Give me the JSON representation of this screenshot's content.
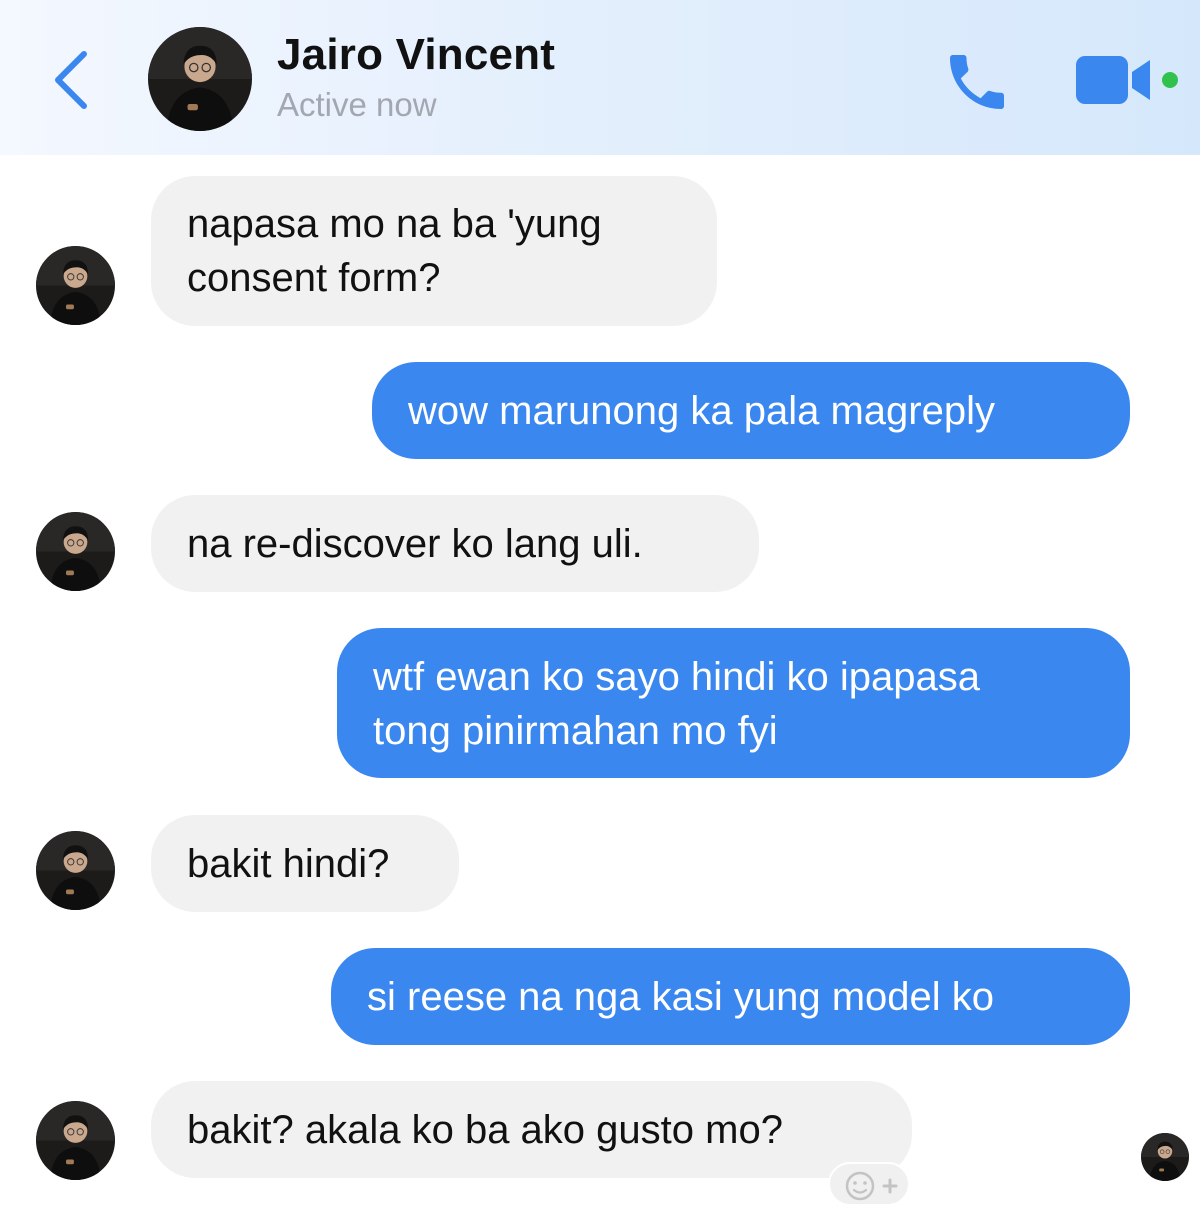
{
  "header": {
    "contact_name": "Jairo Vincent",
    "status": "Active now"
  },
  "colors": {
    "accent": "#3a87f0",
    "incoming_bubble": "#f1f1f1",
    "online_dot": "#31c24d"
  },
  "icons": {
    "back": "chevron-left-icon",
    "call": "phone-icon",
    "video": "video-camera-icon",
    "react": "add-reaction-icon"
  },
  "messages": [
    {
      "direction": "incoming",
      "lines": [
        "napasa mo na ba 'yung",
        "consent form?"
      ]
    },
    {
      "direction": "outgoing",
      "lines": [
        "wow marunong ka pala magreply"
      ]
    },
    {
      "direction": "incoming",
      "lines": [
        "na re-discover ko lang uli."
      ]
    },
    {
      "direction": "outgoing",
      "lines": [
        "wtf ewan ko sayo hindi ko ipapasa",
        "tong pinirmahan mo fyi"
      ]
    },
    {
      "direction": "incoming",
      "lines": [
        "bakit hindi?"
      ]
    },
    {
      "direction": "outgoing",
      "lines": [
        "si reese na nga kasi yung model ko"
      ]
    },
    {
      "direction": "incoming",
      "lines": [
        "bakit? akala ko ba ako gusto mo?"
      ]
    }
  ]
}
